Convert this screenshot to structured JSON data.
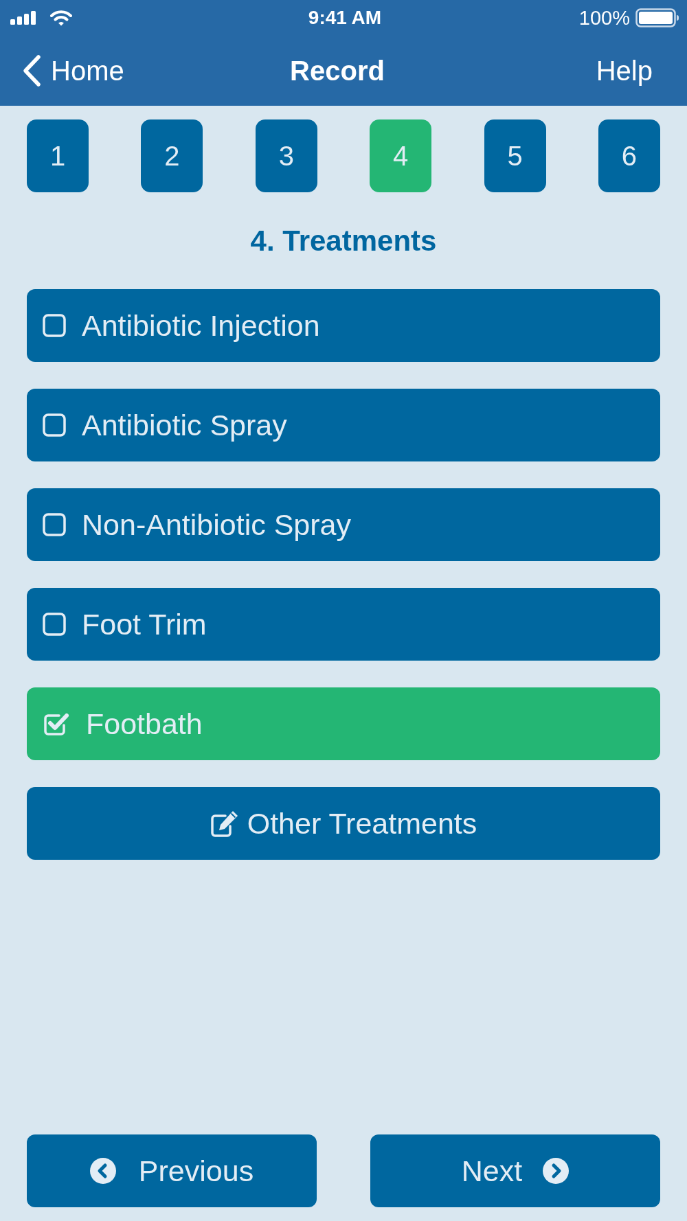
{
  "status_bar": {
    "time": "9:41 AM",
    "battery": "100%"
  },
  "nav": {
    "back": "Home",
    "title": "Record",
    "action": "Help"
  },
  "steps": [
    {
      "label": "1",
      "selected": false
    },
    {
      "label": "2",
      "selected": false
    },
    {
      "label": "3",
      "selected": false
    },
    {
      "label": "4",
      "selected": true
    },
    {
      "label": "5",
      "selected": false
    },
    {
      "label": "6",
      "selected": false
    }
  ],
  "section_title": "4. Treatments",
  "options": [
    {
      "label": "Antibiotic Injection",
      "checked": false
    },
    {
      "label": "Antibiotic Spray",
      "checked": false
    },
    {
      "label": "Non-Antibiotic Spray",
      "checked": false
    },
    {
      "label": "Foot Trim",
      "checked": false
    },
    {
      "label": "Footbath",
      "checked": true
    }
  ],
  "other_button": {
    "label": "Other Treatments"
  },
  "footer": {
    "previous": "Previous",
    "next": "Next"
  }
}
